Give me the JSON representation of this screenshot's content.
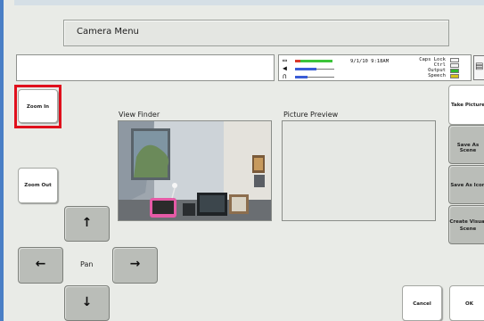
{
  "title_bar": {
    "title": "Camera Menu"
  },
  "status": {
    "datetime": "9/1/10 9:18AM",
    "caps_lock": "Caps Lock",
    "ctrl": "Ctrl",
    "output": "Output",
    "speech": "Speech",
    "icons": [
      "battery-icon",
      "speaker-icon",
      "headphones-icon",
      "keyboard-icon"
    ],
    "colors": {
      "meter_red": "#d83a2a",
      "meter_green": "#3cc43a",
      "meter_blue": "#3a5cd6",
      "output_green": "#2fb82f",
      "speech_yellow": "#d6c21a"
    }
  },
  "left_buttons": {
    "zoom_in": "Zoom In",
    "zoom_out": "Zoom Out"
  },
  "view_finder": {
    "label": "View Finder"
  },
  "picture_preview": {
    "label": "Picture Preview"
  },
  "pan": {
    "label": "Pan",
    "up": "↑",
    "left": "←",
    "right": "→",
    "down": "↓"
  },
  "right_buttons": {
    "take_picture": "Take Picture",
    "save_as_scene": "Save As Scene",
    "save_as_icon": "Save As Icon",
    "create_visual_scene_line1": "Create Visual",
    "create_visual_scene_line2": "Scene"
  },
  "bottom_buttons": {
    "cancel": "Cancel",
    "ok": "OK"
  },
  "highlight_color": "#e0101c"
}
